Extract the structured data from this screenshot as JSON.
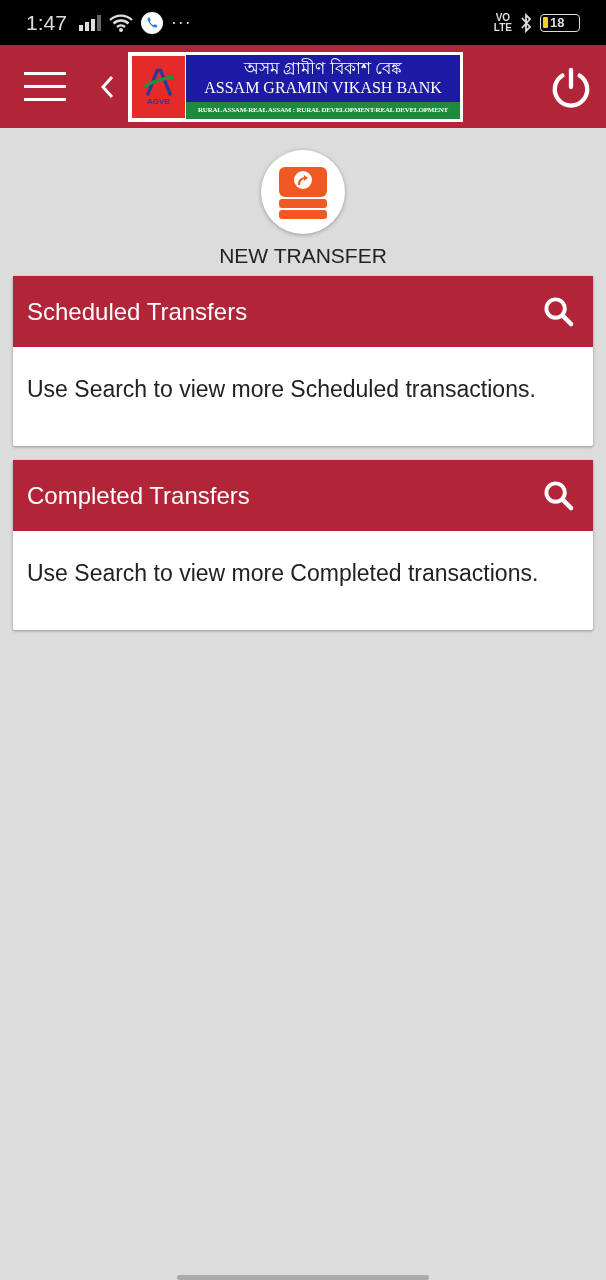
{
  "status_bar": {
    "time": "1:47",
    "more": "···",
    "network": "VO\nLTE",
    "battery": "18"
  },
  "header": {
    "logo": {
      "mark": "AGVB",
      "native_name": "অসম গ্ৰামীণ বিকাশ বেঙ্ক",
      "name": "ASSAM GRAMIN VIKASH BANK",
      "tagline": "RURAL ASSAM-REAL ASSAM : RURAL DEVELOPMENT-REAL DEVELOPMENT"
    }
  },
  "new_transfer": {
    "label": "NEW TRANSFER"
  },
  "sections": [
    {
      "title": "Scheduled Transfers",
      "message": "Use Search to view more Scheduled transactions."
    },
    {
      "title": "Completed Transfers",
      "message": "Use Search to view more Completed transactions."
    }
  ]
}
